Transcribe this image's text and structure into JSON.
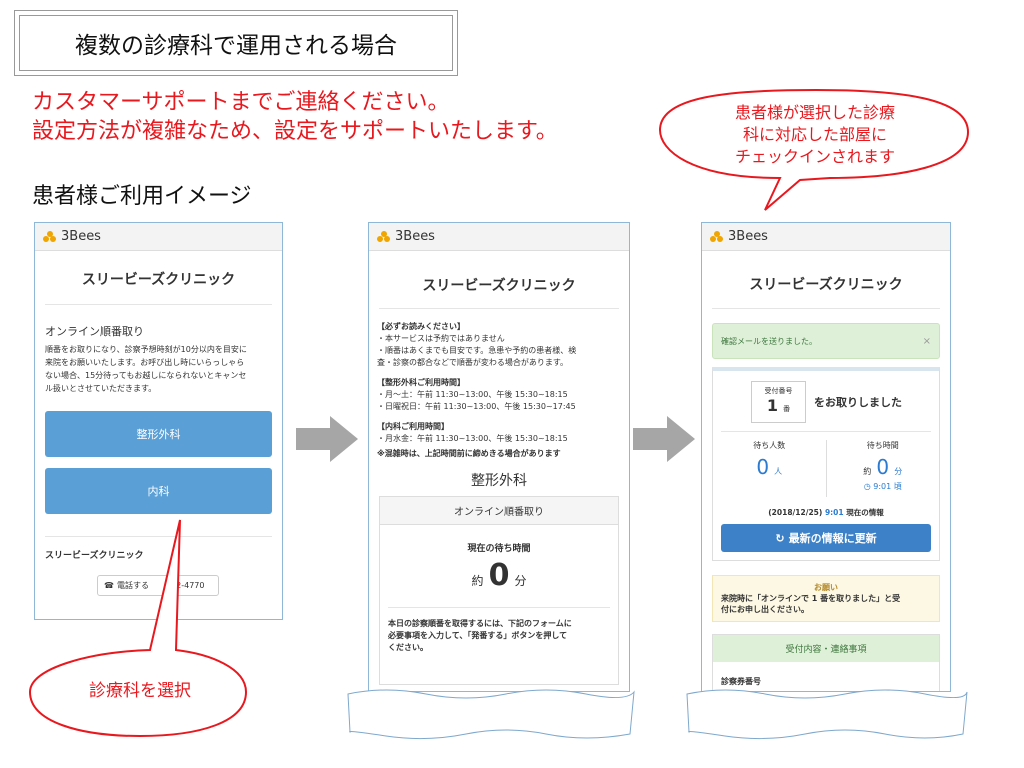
{
  "slide": {
    "title": "複数の診療科で運用される場合",
    "red_message_line1": "カスタマーサポートまでご連絡ください。",
    "red_message_line2": "設定方法が複雑なため、設定をサポートいたします。",
    "section_label": "患者様ご利用イメージ",
    "callout_top_lines": [
      "患者様が選択した診療",
      "科に対応した部屋に",
      "チェックインされます"
    ],
    "callout_bottom": "診療科を選択",
    "accent_red": "#e8181e"
  },
  "brand": {
    "name": "3Bees",
    "clinic": "スリービーズクリニック"
  },
  "phone1": {
    "heading": "オンライン順番取り",
    "desc_lines": [
      "順番をお取りになり、診察予想時刻が10分以内を目安に",
      "来院をお願いいたします。お呼び出し時にいらっしゃら",
      "ない場合、15分待ってもお越しになられないとキャンセ",
      "ル扱いとさせていただきます。"
    ],
    "btn_ortho": "整形外科",
    "btn_internal": "内科",
    "footer_clinic": "スリービーズクリニック",
    "phone_btn_left": "電話する",
    "phone_btn_right": "402-4770"
  },
  "phone2": {
    "notice_title": "【必ずお読みください】",
    "notice_lines": [
      "・本サービスは予約ではありません",
      "・順番はあくまでも目安です。急患や予約の患者様、検",
      "査・診察の都合などで順番が変わる場合があります。"
    ],
    "ortho_hours_title": "【整形外科ご利用時間】",
    "ortho_hours": [
      "・月～土：午前 11:30~13:00、午後 15:30~18:15",
      "・日曜祝日：午前 11:30~13:00、午後 15:30~17:45"
    ],
    "internal_hours_title": "【内科ご利用時間】",
    "internal_hours": [
      "・月水金：午前 11:30~13:00、午後 15:30~18:15"
    ],
    "congestion_note": "※混雑時は、上記時間前に締めきる場合があります",
    "dept": "整形外科",
    "panel_title": "オンライン順番取り",
    "wait_label": "現在の待ち時間",
    "wait_prefix": "約",
    "wait_value": "0",
    "wait_unit": "分",
    "form_lines": [
      "本日の診察順番を取得するには、下記のフォームに",
      "必要事項を入力して、「発番する」ボタンを押して",
      "ください。"
    ]
  },
  "phone3": {
    "alert": "確認メールを送りました。",
    "alert_close": "×",
    "ticket_label": "受付番号",
    "ticket_number": "1",
    "ticket_suffix": "番",
    "taken_text": "をお取りしました",
    "waiting_people_label": "待ち人数",
    "waiting_people_value": "0",
    "waiting_people_unit": "人",
    "wait_time_label": "待ち時間",
    "wait_time_prefix": "約",
    "wait_time_value": "0",
    "wait_time_unit": "分",
    "eta": "9:01 頃",
    "info_date": "(2018/12/25)",
    "info_time": "9:01",
    "info_suffix": "現在の情報",
    "refresh_btn": "最新の情報に更新",
    "notice_title": "お願い",
    "notice_line1": "来院時に「オンラインで 1 番を取りました」と受",
    "notice_line2": "付にお申し出ください。",
    "reception_header": "受付内容・連絡事項",
    "card_label": "診察券番号"
  }
}
